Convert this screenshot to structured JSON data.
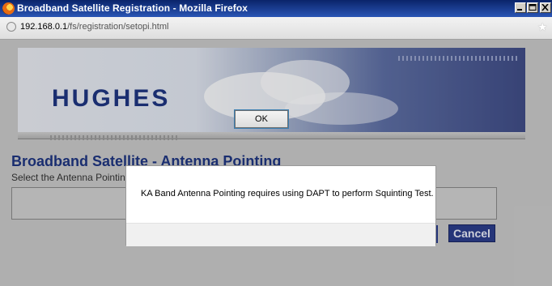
{
  "window": {
    "title": "Broadband Satellite Registration - Mozilla Firefox"
  },
  "addressbar": {
    "url_host": "192.168.0.1",
    "url_path": "/fs/registration/setopi.html"
  },
  "banner": {
    "logo_text": "HUGHES"
  },
  "page": {
    "heading": "Broadband Satellite - Antenna Pointing",
    "instruction": "Select the Antenna Pointin",
    "cancel_label": "Cancel"
  },
  "dialog": {
    "message": "KA Band Antenna Pointing requires using DAPT to perform Squinting Test.",
    "ok_label": "OK"
  },
  "colors": {
    "titlebar": "#0a246a",
    "brand_blue": "#1e3580",
    "button_blue": "#2b3d8a"
  }
}
